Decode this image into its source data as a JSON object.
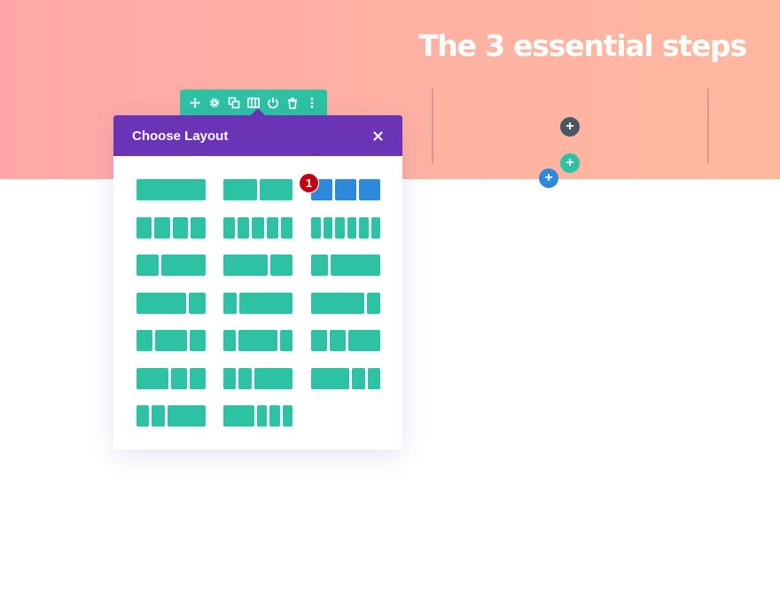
{
  "hero": {
    "title": "The 3 essential steps"
  },
  "toolbar": {
    "icons": [
      "move-icon",
      "settings-icon",
      "duplicate-icon",
      "columns-icon",
      "power-icon",
      "trash-icon",
      "more-icon"
    ]
  },
  "modal": {
    "title": "Choose Layout",
    "close_icon": "close-icon"
  },
  "badge": {
    "number": "1"
  },
  "add_buttons": {
    "plus": "+"
  },
  "colors": {
    "accent_teal": "#2dc2a4",
    "accent_purple": "#6b33b6",
    "selected_blue": "#2e89dd",
    "badge_red": "#c00012",
    "hero_start": "#ffa7a8",
    "hero_end": "#ffb8a0"
  },
  "layouts": [
    {
      "ratios": [
        1
      ]
    },
    {
      "ratios": [
        1,
        1
      ]
    },
    {
      "ratios": [
        1,
        1,
        1
      ],
      "selected": true
    },
    {
      "ratios": [
        1,
        1,
        1,
        1
      ]
    },
    {
      "ratios": [
        1,
        1,
        1,
        1,
        1
      ]
    },
    {
      "ratios": [
        1,
        1,
        1,
        1,
        1,
        1
      ]
    },
    {
      "ratios": [
        1,
        2
      ]
    },
    {
      "ratios": [
        2,
        1
      ]
    },
    {
      "ratios": [
        1,
        3
      ]
    },
    {
      "ratios": [
        3,
        1
      ]
    },
    {
      "ratios": [
        1,
        4
      ]
    },
    {
      "ratios": [
        4,
        1
      ]
    },
    {
      "ratios": [
        1,
        2,
        1
      ]
    },
    {
      "ratios": [
        1,
        3,
        1
      ]
    },
    {
      "ratios": [
        1,
        1,
        2
      ]
    },
    {
      "ratios": [
        2,
        1,
        1
      ]
    },
    {
      "ratios": [
        1,
        1,
        3
      ]
    },
    {
      "ratios": [
        3,
        1,
        1
      ]
    },
    {
      "ratios": [
        1,
        1,
        3
      ]
    },
    {
      "ratios": [
        3,
        1,
        1,
        1
      ]
    }
  ]
}
